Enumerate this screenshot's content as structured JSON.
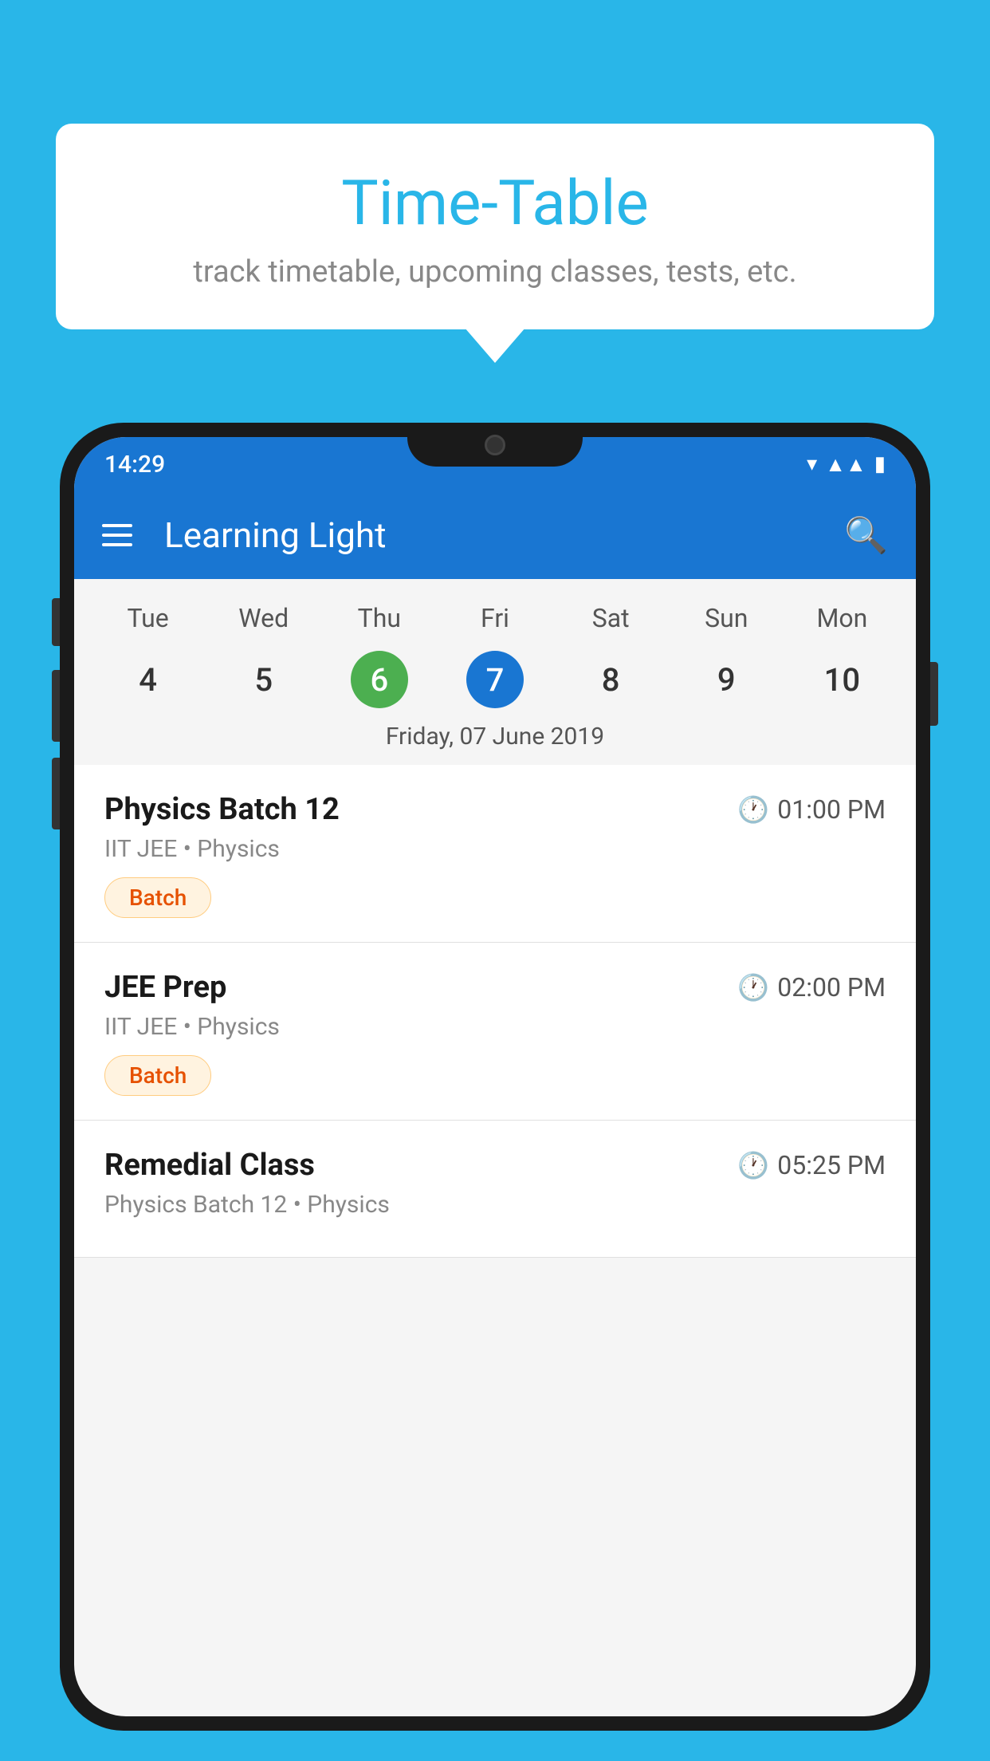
{
  "page": {
    "background_color": "#29b6e8"
  },
  "speech_bubble": {
    "title": "Time-Table",
    "subtitle": "track timetable, upcoming classes, tests, etc."
  },
  "app_bar": {
    "title": "Learning Light",
    "hamburger_label": "menu",
    "search_label": "search"
  },
  "status_bar": {
    "time": "14:29"
  },
  "calendar": {
    "days": [
      "Tue",
      "Wed",
      "Thu",
      "Fri",
      "Sat",
      "Sun",
      "Mon"
    ],
    "dates": [
      "4",
      "5",
      "6",
      "7",
      "8",
      "9",
      "10"
    ],
    "today_index": 2,
    "selected_index": 3,
    "selected_date_label": "Friday, 07 June 2019"
  },
  "classes": [
    {
      "name": "Physics Batch 12",
      "time": "01:00 PM",
      "meta": "IIT JEE • Physics",
      "badge": "Batch"
    },
    {
      "name": "JEE Prep",
      "time": "02:00 PM",
      "meta": "IIT JEE • Physics",
      "badge": "Batch"
    },
    {
      "name": "Remedial Class",
      "time": "05:25 PM",
      "meta": "Physics Batch 12 • Physics",
      "badge": null
    }
  ]
}
